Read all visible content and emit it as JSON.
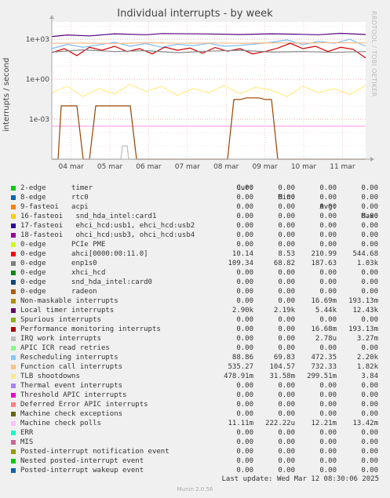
{
  "chart_data": {
    "type": "line",
    "title": "Individual interrupts - by week",
    "ylabel": "interrupts / second",
    "yscale": "log",
    "y_ticks": [
      {
        "value": 0.001,
        "label": "1e-03"
      },
      {
        "value": 1,
        "label": "1e+00"
      },
      {
        "value": 1000,
        "label": "1e+03"
      }
    ],
    "x_ticks": [
      "04 mar",
      "05 mar",
      "06 mar",
      "07 mar",
      "08 mar",
      "09 mar",
      "10 mar",
      "11 mar"
    ],
    "grid": true,
    "series": [
      {
        "name": "Local timer interrupts",
        "color": "#550080",
        "x": [
          0,
          0.05,
          0.12,
          0.2,
          0.3,
          0.35,
          0.5,
          0.6,
          0.7,
          0.78,
          0.85,
          0.92,
          1
        ],
        "values": [
          1600,
          2100,
          1800,
          2600,
          2200,
          2700,
          2500,
          2300,
          2600,
          2400,
          2200,
          2800,
          2300
        ]
      },
      {
        "name": "Rescheduling interrupts",
        "color": "#77bbff",
        "x": [
          0,
          0.05,
          0.1,
          0.15,
          0.2,
          0.25,
          0.3,
          0.35,
          0.4,
          0.45,
          0.5,
          0.55,
          0.6,
          0.65,
          0.7,
          0.75,
          0.8,
          0.85,
          0.9,
          0.95,
          1
        ],
        "values": [
          200,
          420,
          250,
          380,
          600,
          300,
          480,
          250,
          420,
          330,
          500,
          300,
          350,
          450,
          600,
          900,
          400,
          700,
          500,
          1000,
          300
        ]
      },
      {
        "name": "Function call interrupts",
        "color": "#ffbb88",
        "x": [
          0,
          0.1,
          0.2,
          0.3,
          0.4,
          0.5,
          0.6,
          0.7,
          0.8,
          0.9,
          1
        ],
        "values": [
          500,
          520,
          480,
          550,
          500,
          530,
          510,
          540,
          520,
          560,
          535
        ]
      },
      {
        "name": "ahci[0000:00:11.0]",
        "color": "#cc0000",
        "x": [
          0,
          0.04,
          0.08,
          0.12,
          0.16,
          0.2,
          0.24,
          0.28,
          0.32,
          0.36,
          0.4,
          0.44,
          0.48,
          0.52,
          0.56,
          0.6,
          0.64,
          0.68,
          0.72,
          0.76,
          0.8,
          0.84,
          0.88,
          0.92,
          0.96,
          1
        ],
        "values": [
          100,
          200,
          60,
          250,
          150,
          300,
          120,
          200,
          80,
          260,
          150,
          220,
          90,
          240,
          130,
          200,
          80,
          120,
          220,
          500,
          200,
          300,
          120,
          250,
          180,
          40
        ]
      },
      {
        "name": "enp1s0",
        "color": "#888888",
        "x": [
          0,
          0.1,
          0.2,
          0.3,
          0.4,
          0.5,
          0.6,
          0.7,
          0.8,
          0.9,
          1
        ],
        "values": [
          110,
          160,
          120,
          140,
          100,
          130,
          150,
          110,
          120,
          105,
          120
        ]
      },
      {
        "name": "TLB shootdowns",
        "color": "#ffee88",
        "x": [
          0,
          0.05,
          0.1,
          0.15,
          0.2,
          0.25,
          0.3,
          0.35,
          0.4,
          0.45,
          0.5,
          0.55,
          0.6,
          0.65,
          0.7,
          0.75,
          0.8,
          0.85,
          0.9,
          0.95,
          1
        ],
        "values": [
          0.1,
          0.3,
          0.05,
          0.2,
          0.08,
          0.4,
          0.12,
          0.3,
          0.06,
          0.2,
          0.1,
          0.35,
          0.08,
          0.25,
          0.15,
          0.05,
          0.3,
          0.1,
          0.2,
          0.07,
          0.35
        ]
      },
      {
        "name": "Machine check polls",
        "color": "#ffaaee",
        "x": [
          0,
          1
        ],
        "values": [
          0.0003,
          0.0003
        ]
      },
      {
        "name": "radeon",
        "color": "#994400",
        "x": [
          0,
          0.02,
          0.03,
          0.08,
          0.1,
          0.12,
          0.14,
          0.25,
          0.27,
          0.3,
          0.32,
          0.56,
          0.58,
          0.6,
          0.62,
          0.66,
          0.68,
          0.7,
          0.72,
          1
        ],
        "values": [
          0,
          0,
          0.01,
          0.01,
          0,
          0,
          0.01,
          0.01,
          0,
          0,
          0,
          0,
          0.03,
          0.03,
          0.04,
          0.04,
          0.03,
          0.03,
          0,
          0
        ]
      },
      {
        "name": "IRQ work interrupts",
        "color": "#bbbbbb",
        "x": [
          0,
          0.22,
          0.225,
          0.24,
          0.245,
          1
        ],
        "values": [
          0,
          0,
          1e-05,
          1e-05,
          0,
          0
        ]
      }
    ],
    "legend": {
      "headers": [
        "Cur:",
        "Min:",
        "Avg:",
        "Max:"
      ],
      "rows": [
        {
          "color": "#00cc00",
          "label": "2-edge      timer",
          "cur": "0.00",
          "min": "0.00",
          "avg": "0.00",
          "max": "0.00"
        },
        {
          "color": "#0066b3",
          "label": "8-edge      rtc0",
          "cur": "0.00",
          "min": "0.00",
          "avg": "0.00",
          "max": "0.00"
        },
        {
          "color": "#ff8000",
          "label": "9-fasteoi   acpi",
          "cur": "0.00",
          "min": "0.00",
          "avg": "0.00",
          "max": "0.00"
        },
        {
          "color": "#ffcc00",
          "label": "16-fasteoi   snd_hda_intel:card1",
          "cur": "0.00",
          "min": "0.00",
          "avg": "0.00",
          "max": "0.00"
        },
        {
          "color": "#330099",
          "label": "17-fasteoi   ehci_hcd:usb1, ehci_hcd:usb2",
          "cur": "0.00",
          "min": "0.00",
          "avg": "0.00",
          "max": "0.00"
        },
        {
          "color": "#990099",
          "label": "18-fasteoi   ohci_hcd:usb3, ohci_hcd:usb4",
          "cur": "0.00",
          "min": "0.00",
          "avg": "0.00",
          "max": "0.00"
        },
        {
          "color": "#ccff00",
          "label": "0-edge      PCIe PME",
          "cur": "0.00",
          "min": "0.00",
          "avg": "0.00",
          "max": "0.00"
        },
        {
          "color": "#ff0000",
          "label": "0-edge      ahci[0000:00:11.0]",
          "cur": "10.14",
          "min": "8.53",
          "avg": "210.99",
          "max": "544.68"
        },
        {
          "color": "#808080",
          "label": "0-edge      enp1s0",
          "cur": "109.34",
          "min": "68.82",
          "avg": "187.63",
          "max": "1.03k"
        },
        {
          "color": "#008f00",
          "label": "0-edge      xhci_hcd",
          "cur": "0.00",
          "min": "0.00",
          "avg": "0.00",
          "max": "0.00"
        },
        {
          "color": "#00487d",
          "label": "0-edge      snd_hda_intel:card0",
          "cur": "0.00",
          "min": "0.00",
          "avg": "0.00",
          "max": "0.00"
        },
        {
          "color": "#b35a00",
          "label": "0-edge      radeon",
          "cur": "0.00",
          "min": "0.00",
          "avg": "0.00",
          "max": "0.00"
        },
        {
          "color": "#b38f00",
          "label": "Non-maskable interrupts",
          "cur": "0.00",
          "min": "0.00",
          "avg": "16.69m",
          "max": "193.13m"
        },
        {
          "color": "#6b006b",
          "label": "Local timer interrupts",
          "cur": "2.90k",
          "min": "2.19k",
          "avg": "5.44k",
          "max": "12.43k"
        },
        {
          "color": "#8fb300",
          "label": "Spurious interrupts",
          "cur": "0.00",
          "min": "0.00",
          "avg": "0.00",
          "max": "0.00"
        },
        {
          "color": "#b30000",
          "label": "Performance monitoring interrupts",
          "cur": "0.00",
          "min": "0.00",
          "avg": "16.68m",
          "max": "193.13m"
        },
        {
          "color": "#bebebe",
          "label": "IRQ work interrupts",
          "cur": "0.00",
          "min": "0.00",
          "avg": "2.78u",
          "max": "3.27m"
        },
        {
          "color": "#80ff80",
          "label": "APIC ICR read retries",
          "cur": "0.00",
          "min": "0.00",
          "avg": "0.00",
          "max": "0.00"
        },
        {
          "color": "#80c9ff",
          "label": "Rescheduling interrupts",
          "cur": "88.86",
          "min": "69.83",
          "avg": "472.35",
          "max": "2.20k"
        },
        {
          "color": "#ffc080",
          "label": "Function call interrupts",
          "cur": "535.27",
          "min": "104.57",
          "avg": "732.33",
          "max": "1.82k"
        },
        {
          "color": "#ffe680",
          "label": "TLB shootdowns",
          "cur": "478.91m",
          "min": "31.58m",
          "avg": "299.51m",
          "max": "3.84"
        },
        {
          "color": "#aa80ff",
          "label": "Thermal event interrupts",
          "cur": "0.00",
          "min": "0.00",
          "avg": "0.00",
          "max": "0.00"
        },
        {
          "color": "#ee00cc",
          "label": "Threshold APIC interrupts",
          "cur": "0.00",
          "min": "0.00",
          "avg": "0.00",
          "max": "0.00"
        },
        {
          "color": "#ff8080",
          "label": "Deferred Error APIC interrupts",
          "cur": "0.00",
          "min": "0.00",
          "avg": "0.00",
          "max": "0.00"
        },
        {
          "color": "#666600",
          "label": "Machine check exceptions",
          "cur": "0.00",
          "min": "0.00",
          "avg": "0.00",
          "max": "0.00"
        },
        {
          "color": "#ffbfff",
          "label": "Machine check polls",
          "cur": "11.11m",
          "min": "222.22u",
          "avg": "12.21m",
          "max": "13.42m"
        },
        {
          "color": "#00ffcc",
          "label": "ERR",
          "cur": "0.00",
          "min": "0.00",
          "avg": "0.00",
          "max": "0.00"
        },
        {
          "color": "#cc6699",
          "label": "MIS",
          "cur": "0.00",
          "min": "0.00",
          "avg": "0.00",
          "max": "0.00"
        },
        {
          "color": "#999900",
          "label": "Posted-interrupt notification event",
          "cur": "0.00",
          "min": "0.00",
          "avg": "0.00",
          "max": "0.00"
        },
        {
          "color": "#00cc00",
          "label": "Nested posted-interrupt event",
          "cur": "0.00",
          "min": "0.00",
          "avg": "0.00",
          "max": "0.00"
        },
        {
          "color": "#0066b3",
          "label": "Posted-interrupt wakeup event",
          "cur": "0.00",
          "min": "0.00",
          "avg": "0.00",
          "max": "0.00"
        }
      ]
    }
  },
  "footer": {
    "last_update": "Last update: Wed Mar 12 08:30:06 2025",
    "version": "Munin 2.0.56",
    "watermark": "RRDTOOL / TOBI OETIKER"
  }
}
